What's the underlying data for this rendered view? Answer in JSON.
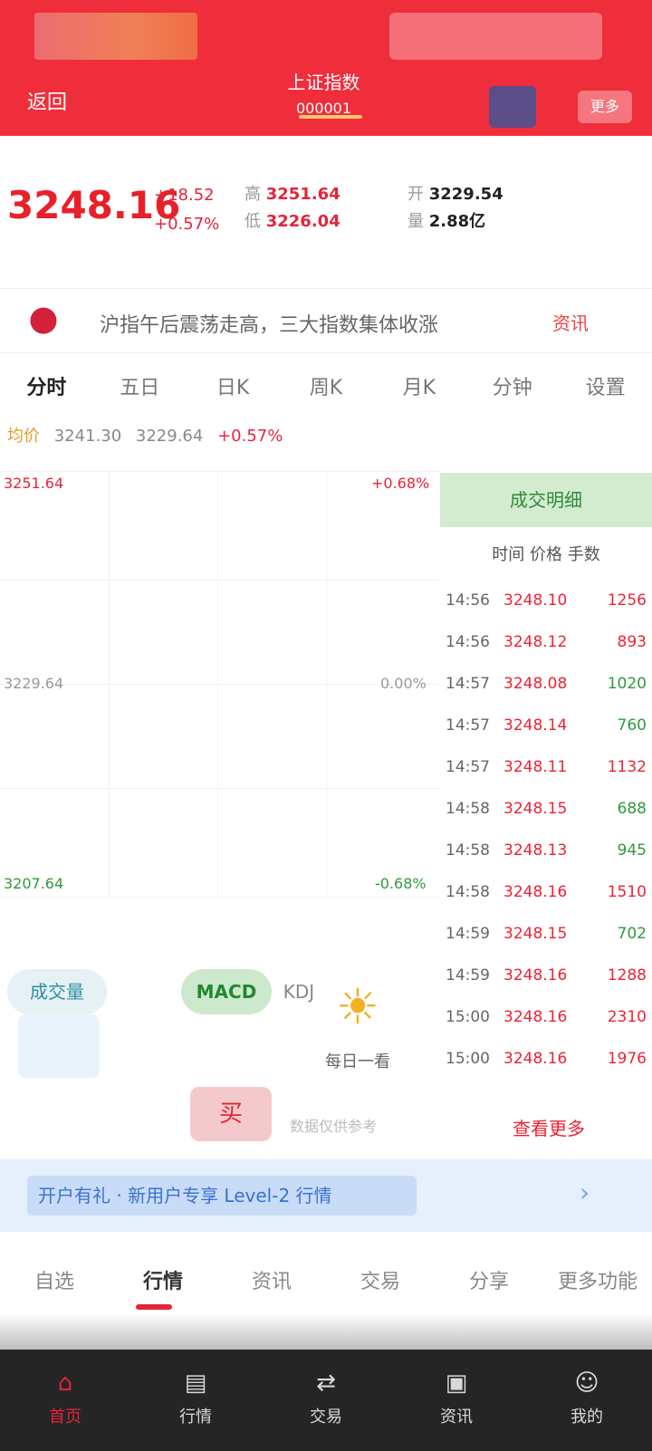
{
  "header": {
    "left_label": "返回",
    "title": "上证指数",
    "subtitle": "000001",
    "more_label": "更多"
  },
  "stock": {
    "price": "3248.16",
    "change": "+18.52",
    "change_pct": "+0.57%",
    "fields": [
      {
        "k": "高",
        "v": "3251.64"
      },
      {
        "k": "低",
        "v": "3226.04"
      },
      {
        "k": "开",
        "v": "3229.54"
      },
      {
        "k": "量",
        "v": "2.88亿"
      }
    ]
  },
  "news": {
    "text": "沪指午后震荡走高，三大指数集体收涨",
    "tag": "资讯"
  },
  "tabs": [
    "分时",
    "五日",
    "日K",
    "周K",
    "月K",
    "分钟",
    "设置"
  ],
  "tabs_active": 0,
  "indicators": {
    "label": "均价",
    "ma1": "3241.30",
    "ma2": "3229.64",
    "ma3": "+0.57%"
  },
  "axis": {
    "top_left": "3251.64",
    "mid_left": "3229.64",
    "bottom_left": "3207.64",
    "top_right": "+0.68%",
    "mid_right": "0.00%",
    "bottom_right": "-0.68%"
  },
  "order_book": {
    "header": "成交明细",
    "sub": "时间  价格  手数",
    "rows": [
      {
        "t": "14:56",
        "p": "3248.10",
        "q": "1256",
        "c": "red"
      },
      {
        "t": "14:56",
        "p": "3248.12",
        "q": "893",
        "c": "red"
      },
      {
        "t": "14:57",
        "p": "3248.08",
        "q": "1020",
        "c": "green"
      },
      {
        "t": "14:57",
        "p": "3248.14",
        "q": "760",
        "c": "green"
      },
      {
        "t": "14:57",
        "p": "3248.11",
        "q": "1132",
        "c": "red"
      },
      {
        "t": "14:58",
        "p": "3248.15",
        "q": "688",
        "c": "green"
      },
      {
        "t": "14:58",
        "p": "3248.13",
        "q": "945",
        "c": "green"
      },
      {
        "t": "14:58",
        "p": "3248.16",
        "q": "1510",
        "c": "red"
      },
      {
        "t": "14:59",
        "p": "3248.15",
        "q": "702",
        "c": "green"
      },
      {
        "t": "14:59",
        "p": "3248.16",
        "q": "1288",
        "c": "red"
      },
      {
        "t": "15:00",
        "p": "3248.16",
        "q": "2310",
        "c": "red"
      },
      {
        "t": "15:00",
        "p": "3248.16",
        "q": "1976",
        "c": "red"
      }
    ],
    "footer": "查看更多"
  },
  "ind_bar": {
    "a": "成交量",
    "b": "MACD",
    "c": "KDJ"
  },
  "sun": {
    "label": "每日一看"
  },
  "red_button": "买",
  "misc_line": "数据仅供参考",
  "banner": {
    "text": "开户有礼 · 新用户专享 Level-2 行情",
    "arrow": "›"
  },
  "actions": [
    "自选",
    "行情",
    "资讯",
    "交易",
    "分享",
    "更多功能"
  ],
  "actions_active": 1,
  "bottom_nav": [
    {
      "label": "首页",
      "icon": "home-icon"
    },
    {
      "label": "行情",
      "icon": "chart-icon"
    },
    {
      "label": "交易",
      "icon": "trade-icon"
    },
    {
      "label": "资讯",
      "icon": "news-icon"
    },
    {
      "label": "我的",
      "icon": "user-icon"
    }
  ],
  "bottom_nav_active": 0,
  "colors": {
    "header_bg": "#f02d3a",
    "up": "#e4243a",
    "down": "#2f9a3c",
    "banner_bg": "#e6effc",
    "nav_bg": "#252525"
  }
}
